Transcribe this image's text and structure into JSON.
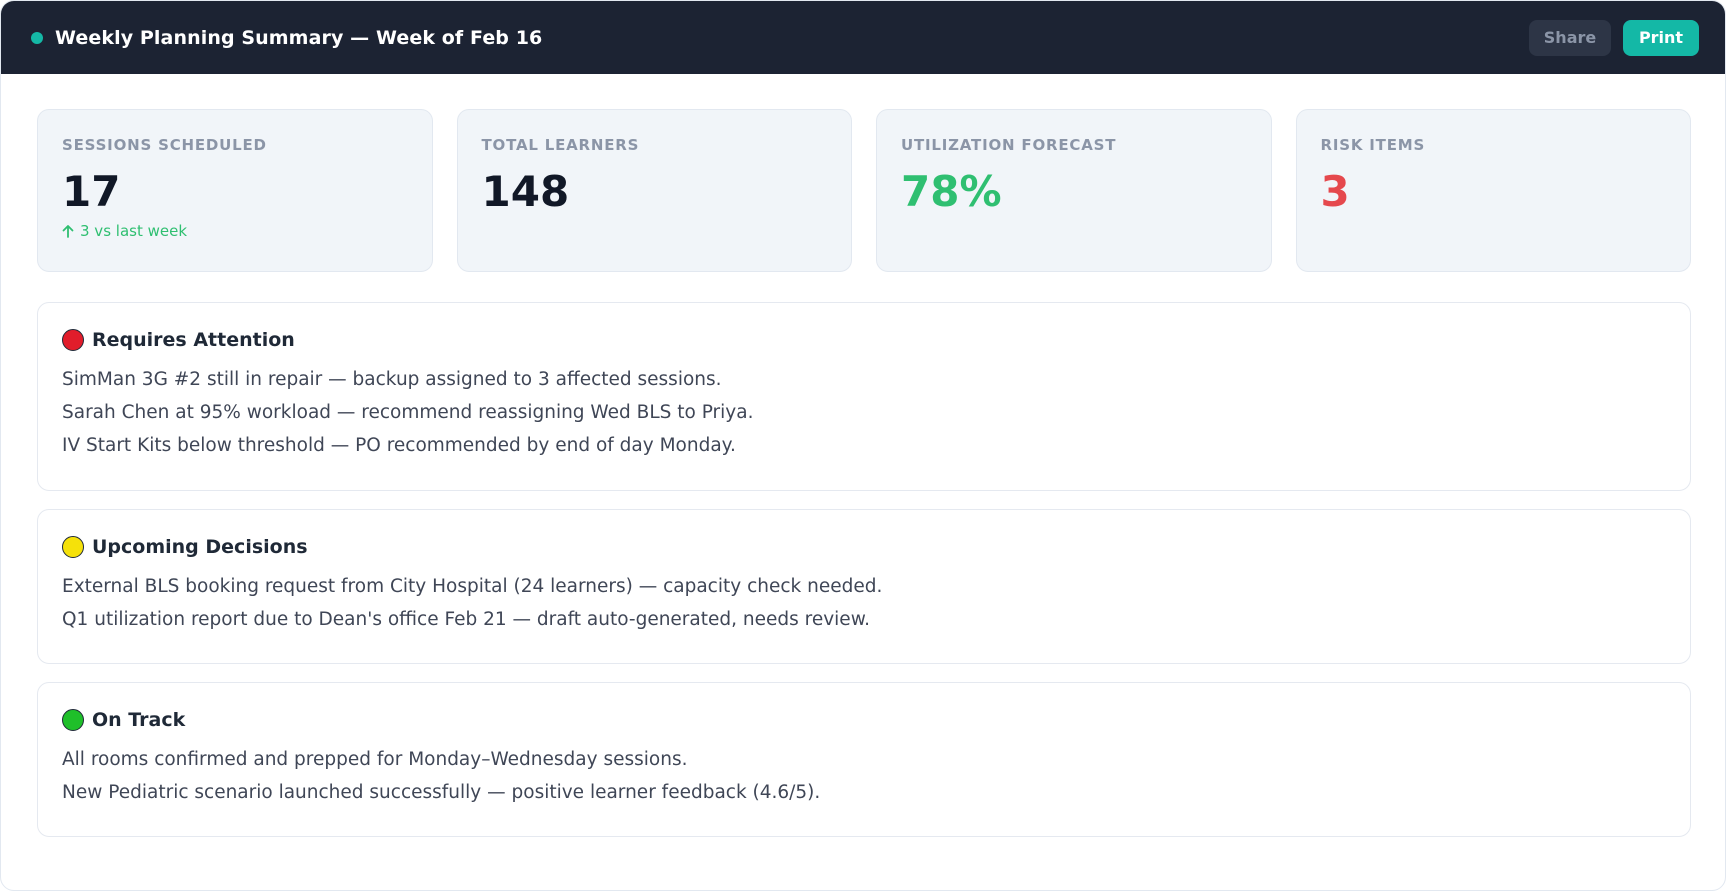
{
  "header": {
    "title": "Weekly Planning Summary — Week of Feb 16",
    "share_label": "Share",
    "print_label": "Print",
    "accent": "#14b8a6",
    "background": "#1c2333"
  },
  "kpis": [
    {
      "label": "SESSIONS SCHEDULED",
      "value": "17",
      "delta": "3 vs last week",
      "value_color": "#111827"
    },
    {
      "label": "TOTAL LEARNERS",
      "value": "148",
      "delta": "",
      "value_color": "#111827"
    },
    {
      "label": "UTILIZATION FORECAST",
      "value": "78%",
      "delta": "",
      "value_color": "#2fbf71"
    },
    {
      "label": "RISK ITEMS",
      "value": "3",
      "delta": "",
      "value_color": "#e5484d"
    }
  ],
  "sections": {
    "attention": {
      "title": "Requires Attention",
      "indicator": "red-circle-icon",
      "items": [
        "SimMan 3G #2 still in repair — backup assigned to 3 affected sessions.",
        "Sarah Chen at 95% workload — recommend reassigning Wed BLS to Priya.",
        "IV Start Kits below threshold — PO recommended by end of day Monday."
      ]
    },
    "decisions": {
      "title": "Upcoming Decisions",
      "indicator": "yellow-circle-icon",
      "items": [
        "External BLS booking request from City Hospital (24 learners) — capacity check needed.",
        "Q1 utilization report due to Dean's office Feb 21 — draft auto-generated, needs review."
      ]
    },
    "ontrack": {
      "title": "On Track",
      "indicator": "green-circle-icon",
      "items": [
        "All rooms confirmed and prepped for Monday–Wednesday sessions.",
        "New Pediatric scenario launched successfully — positive learner feedback (4.6/5)."
      ]
    }
  }
}
